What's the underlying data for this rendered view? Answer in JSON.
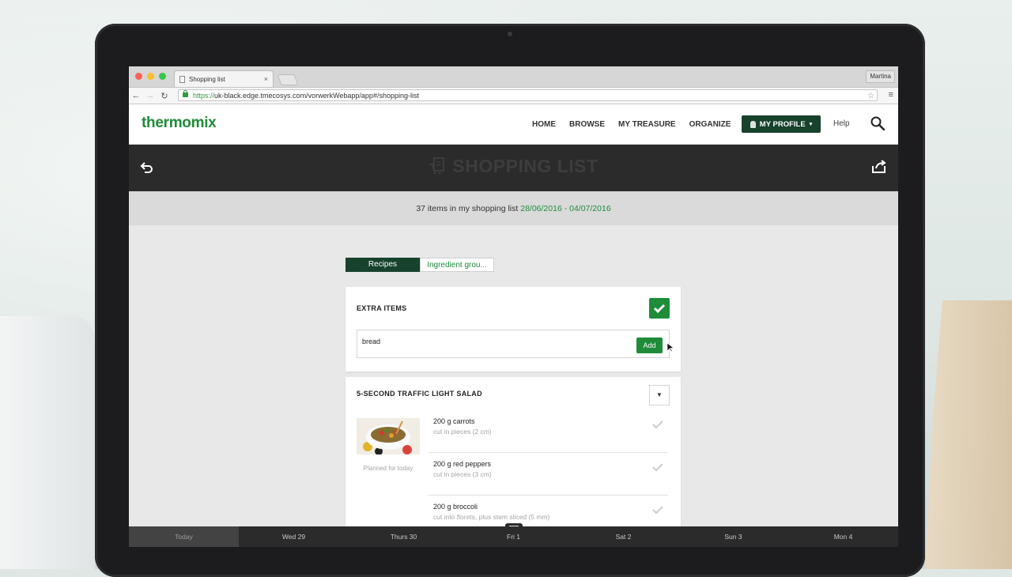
{
  "browser": {
    "tab_title": "Shopping list",
    "tab_close": "×",
    "user": "Martina",
    "url_scheme": "https://",
    "url_rest": "uk-black.edge.tmecosys.com/vorwerkWebapp/app#/shopping-list",
    "back": "←",
    "forward": "→",
    "reload": "↻",
    "star": "☆",
    "menu": "≡"
  },
  "header": {
    "logo": "thermomix",
    "nav": [
      "HOME",
      "BROWSE",
      "MY TREASURE",
      "ORGANIZE"
    ],
    "profile_label": "MY PROFILE",
    "profile_caret": "▾",
    "help": "Help"
  },
  "titlebar": {
    "title": "SHOPPING LIST"
  },
  "summary": {
    "text": "37 items in my shopping list ",
    "range": "28/06/2016 - 04/07/2016"
  },
  "view_toggle": {
    "recipes": "Recipes",
    "ingredients": "Ingredient grou..."
  },
  "extra": {
    "title": "EXTRA ITEMS",
    "input_value": "bread",
    "add_label": "Add"
  },
  "recipe": {
    "title": "5-SECOND TRAFFIC LIGHT SALAD",
    "dropdown": "▼",
    "planned": "Planned for today",
    "ingredients": [
      {
        "name": "200 g carrots",
        "prep": "cut in pieces (2 cm)"
      },
      {
        "name": "200 g red peppers",
        "prep": "cut in pieces (3 cm)"
      },
      {
        "name": "200 g broccoli",
        "prep": "cut into florets, plus stem sliced (5 mm)"
      }
    ]
  },
  "days": [
    "Today",
    "Wed 29",
    "Thurs 30",
    "Fri 1",
    "Sat 2",
    "Sun 3",
    "Mon 4"
  ],
  "colors": {
    "brand_green": "#1e8c39",
    "dark_green": "#17422c",
    "title_bar": "#2b2b2b"
  }
}
